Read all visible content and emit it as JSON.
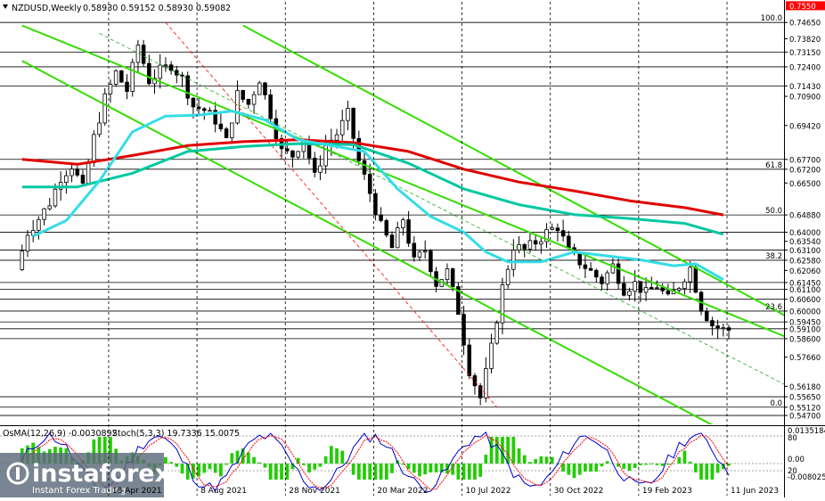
{
  "header": {
    "symbol_label": "NZDUSD,Weekly",
    "ohlc_values": "0.58930 0.59152 0.58930 0.59082"
  },
  "osma_label": "OsMA(12,26,9) -0.0030892",
  "stoch_label": "Stoch(5,3,3) 19.7336 15.0075",
  "logo": {
    "name": "instaforex",
    "tagline": "Instant Forex Trading"
  },
  "colors": {
    "background": "#ffffff",
    "candles": "#000000",
    "ema_red": "#e00000",
    "ema_green": "#00c8a0",
    "ema_cyan": "#33dde8",
    "channel_green": "#33dd00",
    "fib_red_dashed": "#ff0000",
    "price_tag_red": "#ff0000",
    "osma_bars": "#22cc00",
    "stoch_main": "#0000cc",
    "stoch_signal": "#ff0000",
    "level_lines": "#000000",
    "logo_bg": "#5b6a7a"
  },
  "chart_data": {
    "type": "candlestick",
    "symbol": "NZDUSD",
    "timeframe": "Weekly",
    "x_ticks": [
      "18 Apr 2021",
      "8 Aug 2021",
      "28 Nov 2021",
      "20 Mar 2022",
      "10 Jul 2022",
      "30 Oct 2022",
      "19 Feb 2023",
      "11 Jun 2023"
    ],
    "x_tick_weeks": [
      16,
      32,
      48,
      64,
      80,
      96,
      112,
      128
    ],
    "weeks_total": 138,
    "ylim": [
      0.5425,
      0.757
    ],
    "price_tags": [
      {
        "label": "0.7550",
        "value": 0.755,
        "highlight": true
      },
      {
        "label": "0.74650",
        "value": 0.7465,
        "line": true
      },
      {
        "label": "0.73820",
        "value": 0.7382
      },
      {
        "label": "0.73150",
        "value": 0.7315,
        "line": true
      },
      {
        "label": "0.72400",
        "value": 0.724,
        "line": true
      },
      {
        "label": "0.71430",
        "value": 0.7143,
        "line": true
      },
      {
        "label": "0.70900",
        "value": 0.709
      },
      {
        "label": "0.69420",
        "value": 0.6942
      },
      {
        "label": "0.67700",
        "value": 0.677,
        "line": true
      },
      {
        "label": "0.67200",
        "value": 0.672,
        "line": true
      },
      {
        "label": "0.66500",
        "value": 0.665
      },
      {
        "label": "0.64880",
        "value": 0.6488,
        "line": true
      },
      {
        "label": "0.64000",
        "value": 0.64,
        "line": true
      },
      {
        "label": "0.63540",
        "value": 0.6354
      },
      {
        "label": "0.63100",
        "value": 0.631,
        "line": true
      },
      {
        "label": "0.62580",
        "value": 0.6258,
        "line": true
      },
      {
        "label": "0.62060",
        "value": 0.6206
      },
      {
        "label": "0.61450",
        "value": 0.6145,
        "line": true
      },
      {
        "label": "0.61100",
        "value": 0.611,
        "line": true
      },
      {
        "label": "0.60600",
        "value": 0.606,
        "line": true
      },
      {
        "label": "0.60000",
        "value": 0.6,
        "line": true
      },
      {
        "label": "0.59450",
        "value": 0.5945,
        "line": true
      },
      {
        "label": "0.59100",
        "value": 0.591,
        "line": true
      },
      {
        "label": "0.58600",
        "value": 0.586,
        "line": true
      },
      {
        "label": "0.57660",
        "value": 0.5766
      },
      {
        "label": "0.56180",
        "value": 0.5618
      },
      {
        "label": "0.55650",
        "value": 0.5565,
        "line": true
      },
      {
        "label": "0.55120",
        "value": 0.5512,
        "line": true
      },
      {
        "label": "0.54700",
        "value": 0.547,
        "line": true
      }
    ],
    "fib_levels": [
      {
        "label": "100.0",
        "value": 0.7465
      },
      {
        "label": "61.8",
        "value": 0.672
      },
      {
        "label": "50.0",
        "value": 0.6488
      },
      {
        "label": "38.2",
        "value": 0.6258
      },
      {
        "label": "23.6",
        "value": 0.6
      },
      {
        "label": "0.0",
        "value": 0.5512
      }
    ],
    "candle_anchors": [
      [
        0,
        0.621
      ],
      [
        2,
        0.64
      ],
      [
        4,
        0.647
      ],
      [
        6,
        0.655
      ],
      [
        8,
        0.668
      ],
      [
        10,
        0.674
      ],
      [
        12,
        0.662
      ],
      [
        14,
        0.688
      ],
      [
        16,
        0.708
      ],
      [
        18,
        0.721
      ],
      [
        20,
        0.712
      ],
      [
        22,
        0.735
      ],
      [
        24,
        0.717
      ],
      [
        26,
        0.722
      ],
      [
        28,
        0.725
      ],
      [
        30,
        0.718
      ],
      [
        32,
        0.704
      ],
      [
        34,
        0.702
      ],
      [
        36,
        0.697
      ],
      [
        38,
        0.686
      ],
      [
        40,
        0.71
      ],
      [
        42,
        0.705
      ],
      [
        44,
        0.718
      ],
      [
        46,
        0.7
      ],
      [
        48,
        0.681
      ],
      [
        50,
        0.679
      ],
      [
        52,
        0.688
      ],
      [
        54,
        0.668
      ],
      [
        56,
        0.684
      ],
      [
        58,
        0.69
      ],
      [
        60,
        0.7
      ],
      [
        62,
        0.676
      ],
      [
        64,
        0.66
      ],
      [
        66,
        0.643
      ],
      [
        68,
        0.632
      ],
      [
        70,
        0.647
      ],
      [
        72,
        0.625
      ],
      [
        74,
        0.631
      ],
      [
        76,
        0.614
      ],
      [
        78,
        0.62
      ],
      [
        80,
        0.6
      ],
      [
        82,
        0.57
      ],
      [
        84,
        0.556
      ],
      [
        86,
        0.581
      ],
      [
        88,
        0.612
      ],
      [
        90,
        0.633
      ],
      [
        92,
        0.631
      ],
      [
        94,
        0.635
      ],
      [
        96,
        0.64
      ],
      [
        98,
        0.643
      ],
      [
        100,
        0.63
      ],
      [
        102,
        0.625
      ],
      [
        104,
        0.62
      ],
      [
        106,
        0.615
      ],
      [
        108,
        0.623
      ],
      [
        110,
        0.611
      ],
      [
        112,
        0.614
      ],
      [
        114,
        0.609
      ],
      [
        116,
        0.613
      ],
      [
        118,
        0.606
      ],
      [
        120,
        0.613
      ],
      [
        122,
        0.622
      ],
      [
        124,
        0.602
      ],
      [
        126,
        0.593
      ],
      [
        128,
        0.5905
      ]
    ],
    "series": [
      {
        "style": "ema",
        "color": "#e00000",
        "points": [
          [
            0,
            0.677
          ],
          [
            10,
            0.6745
          ],
          [
            20,
            0.679
          ],
          [
            30,
            0.684
          ],
          [
            40,
            0.686
          ],
          [
            50,
            0.687
          ],
          [
            60,
            0.6855
          ],
          [
            70,
            0.681
          ],
          [
            80,
            0.672
          ],
          [
            90,
            0.6655
          ],
          [
            100,
            0.661
          ],
          [
            110,
            0.656
          ],
          [
            120,
            0.6525
          ],
          [
            127,
            0.6488
          ]
        ]
      },
      {
        "style": "ema",
        "color": "#00c8a0",
        "points": [
          [
            0,
            0.663
          ],
          [
            10,
            0.663
          ],
          [
            20,
            0.67
          ],
          [
            30,
            0.681
          ],
          [
            40,
            0.6835
          ],
          [
            50,
            0.685
          ],
          [
            60,
            0.6845
          ],
          [
            70,
            0.675
          ],
          [
            80,
            0.662
          ],
          [
            90,
            0.654
          ],
          [
            100,
            0.649
          ],
          [
            110,
            0.647
          ],
          [
            120,
            0.6445
          ],
          [
            127,
            0.639
          ]
        ]
      },
      {
        "style": "ema",
        "color": "#33dde8",
        "points": [
          [
            2,
            0.638
          ],
          [
            8,
            0.646
          ],
          [
            14,
            0.666
          ],
          [
            20,
            0.691
          ],
          [
            26,
            0.699
          ],
          [
            32,
            0.6995
          ],
          [
            38,
            0.7015
          ],
          [
            44,
            0.697
          ],
          [
            50,
            0.687
          ],
          [
            56,
            0.684
          ],
          [
            62,
            0.681
          ],
          [
            68,
            0.662
          ],
          [
            74,
            0.648
          ],
          [
            80,
            0.64
          ],
          [
            84,
            0.63
          ],
          [
            88,
            0.625
          ],
          [
            94,
            0.625
          ],
          [
            100,
            0.63
          ],
          [
            106,
            0.628
          ],
          [
            112,
            0.626
          ],
          [
            118,
            0.623
          ],
          [
            122,
            0.624
          ],
          [
            127,
            0.616
          ]
        ]
      }
    ],
    "channel_lines": [
      {
        "from": [
          0,
          0.745
        ],
        "to": [
          140,
          0.585
        ]
      },
      {
        "from": [
          0,
          0.727
        ],
        "to": [
          140,
          0.52
        ]
      },
      {
        "from": [
          40,
          0.745
        ],
        "to": [
          140,
          0.595
        ]
      }
    ],
    "fib_diagonal": {
      "from": [
        26,
        0.7465
      ],
      "to": [
        86,
        0.5512
      ]
    },
    "trend_dashed": {
      "from": [
        14,
        0.741
      ],
      "to": [
        140,
        0.56
      ]
    },
    "osma_levels": {
      "top_label": "0.0135184",
      "zero_label": "0.00",
      "bottom_label": "-0.008025"
    },
    "stoch_levels": {
      "upper": "80",
      "lower": "20"
    }
  }
}
